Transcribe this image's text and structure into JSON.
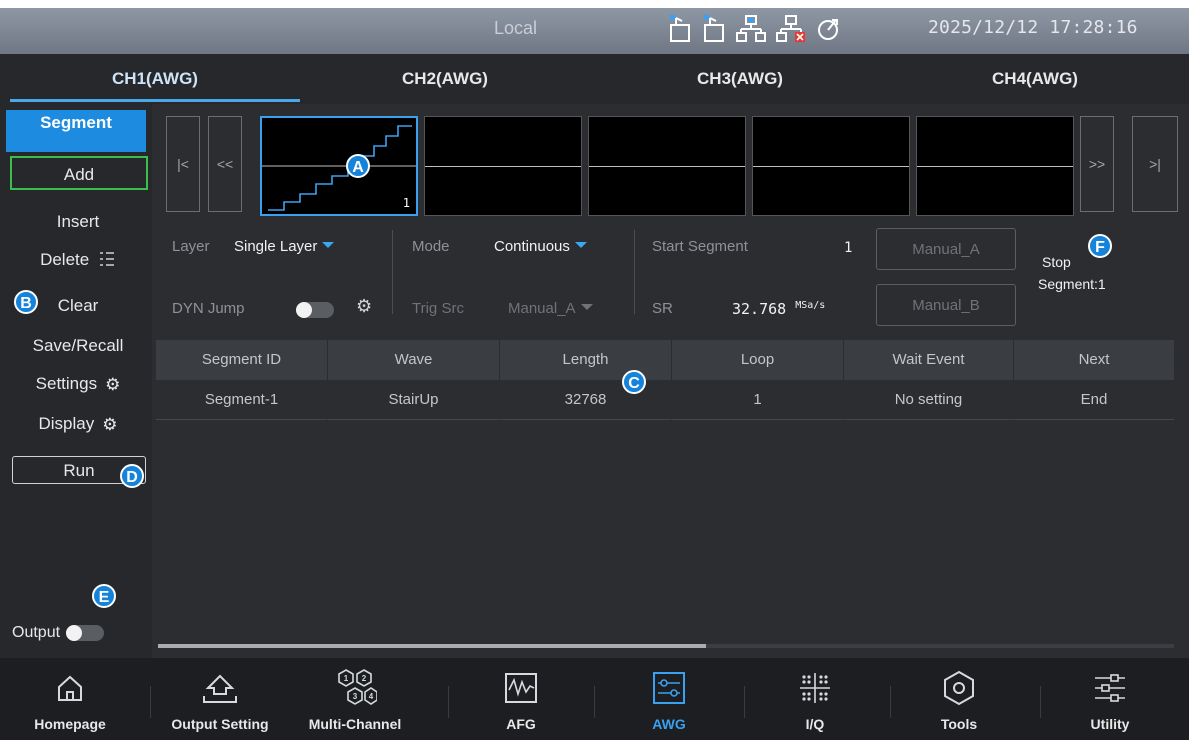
{
  "statusbar": {
    "mode": "Local",
    "datetime": "2025/12/12 17:28:16",
    "icons": [
      "usb-device-icon",
      "usb-host-icon",
      "lan-connected-icon",
      "lan-error-icon",
      "sync-icon"
    ]
  },
  "tabs": [
    "CH1(AWG)",
    "CH2(AWG)",
    "CH3(AWG)",
    "CH4(AWG)"
  ],
  "menu": {
    "title": "Segment",
    "add": "Add",
    "insert": "Insert",
    "delete": "Delete",
    "clear": "Clear",
    "save_recall": "Save/Recall",
    "settings": "Settings",
    "display": "Display",
    "run": "Run",
    "output": "Output"
  },
  "segments": {
    "nav_first": "|<",
    "nav_prev": "<<",
    "nav_next": ">>",
    "nav_last": ">|",
    "thumb_number": "1"
  },
  "params": {
    "layer_label": "Layer",
    "layer_value": "Single Layer",
    "mode_label": "Mode",
    "mode_value": "Continuous",
    "start_label": "Start Segment",
    "start_value": "1",
    "manual_a": "Manual_A",
    "manual_b": "Manual_B",
    "stop_label": "Stop",
    "stop_value": "Segment:1",
    "dyn_label": "DYN Jump",
    "trig_label": "Trig Src",
    "trig_value": "Manual_A",
    "sr_label": "SR",
    "sr_value": "32.768",
    "sr_unit": "MSa/s"
  },
  "table": {
    "headers": [
      "Segment ID",
      "Wave",
      "Length",
      "Loop",
      "Wait Event",
      "Next"
    ],
    "rows": [
      [
        "Segment-1",
        "StairUp",
        "32768",
        "1",
        "No setting",
        "End"
      ]
    ]
  },
  "annotations": [
    "A",
    "B",
    "C",
    "D",
    "E",
    "F"
  ],
  "bottom": [
    "Homepage",
    "Output Setting",
    "Multi-Channel",
    "AFG",
    "AWG",
    "I/Q",
    "Tools",
    "Utility"
  ],
  "colors": {
    "accent": "#1c8be0",
    "active_tab": "#3aa0ef",
    "add_border": "#3bbf4b"
  }
}
